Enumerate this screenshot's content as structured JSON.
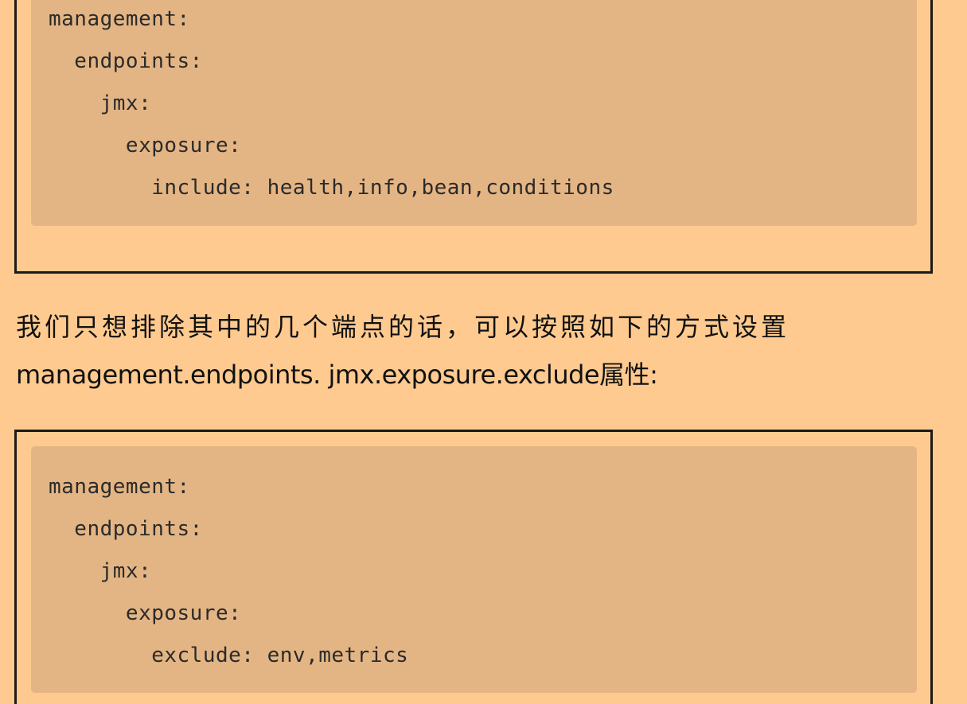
{
  "code_blocks": [
    {
      "lines": [
        "management:",
        "  endpoints:",
        "    jmx:",
        "      exposure:",
        "        include: health,info,bean,conditions"
      ]
    },
    {
      "lines": [
        "management:",
        "  endpoints:",
        "    jmx:",
        "      exposure:",
        "        exclude: env,metrics"
      ]
    }
  ],
  "paragraph": {
    "line1": "我们只想排除其中的几个端点的话，可以按照如下的方式设置",
    "line2": "management.endpoints. jmx.exposure.exclude属性:"
  },
  "colors": {
    "page_background": "#ffca8f",
    "code_background": "#e4b584",
    "border": "#1a1a1a",
    "text": "#111111"
  }
}
